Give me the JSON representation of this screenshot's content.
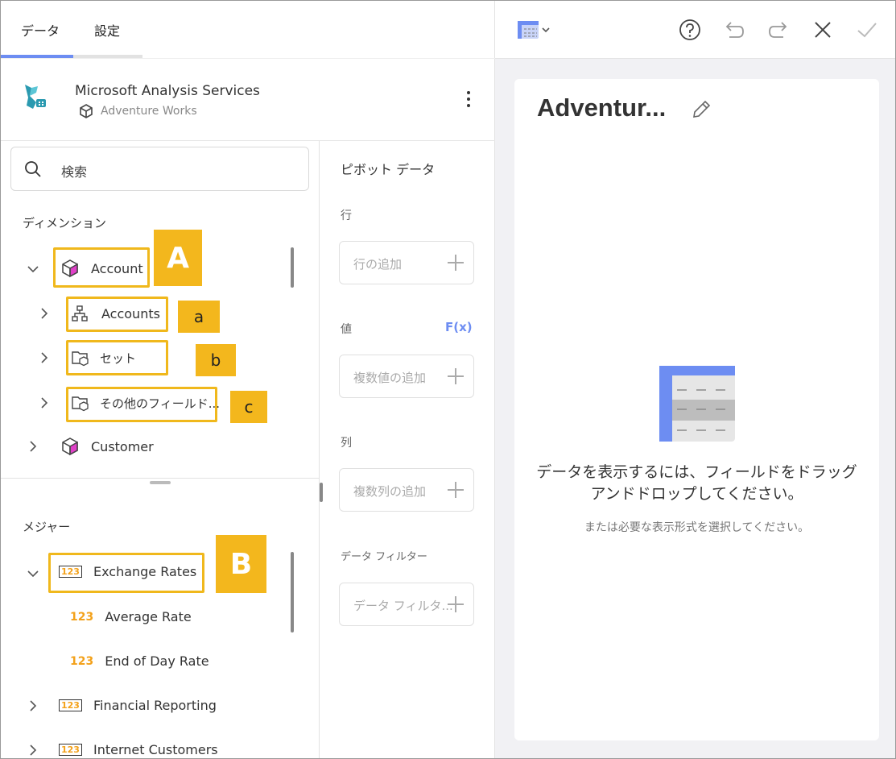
{
  "tabs": {
    "data": "データ",
    "settings": "設定"
  },
  "source": {
    "title": "Microsoft Analysis Services",
    "subtitle": "Adventure Works"
  },
  "search": {
    "placeholder": "検索"
  },
  "dimensions": {
    "title": "ディメンション",
    "account": "Account",
    "accounts": "Accounts",
    "set": "セット",
    "other": "その他のフィールド...",
    "customer": "Customer"
  },
  "measures": {
    "title": "メジャー",
    "exchange": "Exchange Rates",
    "average": "Average Rate",
    "endofday": "End of Day Rate",
    "financial": "Financial Reporting",
    "internet": "Internet Customers",
    "icon_text": "123"
  },
  "badges": {
    "A": "A",
    "a": "a",
    "b": "b",
    "c": "c",
    "B": "B"
  },
  "pivot": {
    "title": "ピボット データ",
    "rows_label": "行",
    "rows_add": "行の追加",
    "values_label": "値",
    "fx": "F(x)",
    "values_add": "複数値の追加",
    "cols_label": "列",
    "cols_add": "複数列の追加",
    "filter_label": "データ フィルター",
    "filter_add": "データ フィルタ..."
  },
  "card": {
    "title": "Adventur...",
    "message_line1": "データを表示するには、フィールドをドラッグ",
    "message_line2": "アンドドロップしてください。",
    "sub": "または必要な表示形式を選択してください。"
  },
  "colors": {
    "accent": "#6d8df2",
    "highlight": "#f3b71d",
    "cube": "#e040c8",
    "measure": "#f3a11a"
  }
}
